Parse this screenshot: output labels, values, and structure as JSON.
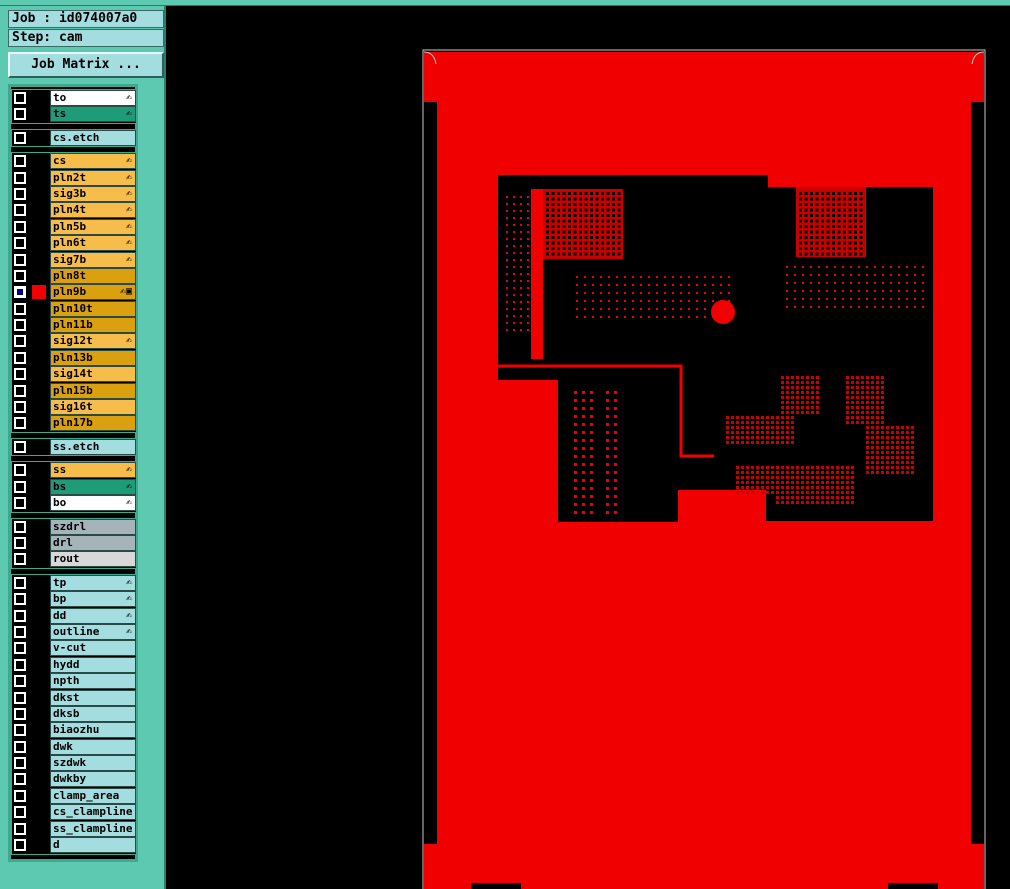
{
  "job": {
    "label": "Job : id074007a0"
  },
  "step": {
    "label": "Step: cam"
  },
  "job_matrix_button": "Job Matrix ...",
  "colors": {
    "panel": "#5cc9b0",
    "layer_white": "#ffffff",
    "layer_green": "#1e9c78",
    "layer_cyan": "#a4dde0",
    "layer_orange": "#f7bd4a",
    "layer_darkorange": "#dba00f",
    "layer_gray": "#a6b3b8",
    "layer_lightgray": "#d8d8d8",
    "board_red": "#f00000"
  },
  "layer_groups": [
    {
      "layers": [
        {
          "name": "to",
          "color": "#ffffff",
          "flag": "✍"
        },
        {
          "name": "ts",
          "color": "#1e9c78",
          "flag": "✍"
        }
      ]
    },
    {
      "layers": [
        {
          "name": "cs.etch",
          "color": "#a4dde0",
          "flag": ""
        }
      ]
    },
    {
      "layers": [
        {
          "name": "cs",
          "color": "#f7bd4a",
          "flag": "✍"
        },
        {
          "name": "pln2t",
          "color": "#f7bd4a",
          "flag": "✍"
        },
        {
          "name": "sig3b",
          "color": "#f7bd4a",
          "flag": "✍"
        },
        {
          "name": "pln4t",
          "color": "#f7bd4a",
          "flag": "✍"
        },
        {
          "name": "pln5b",
          "color": "#f7bd4a",
          "flag": "✍"
        },
        {
          "name": "pln6t",
          "color": "#f7bd4a",
          "flag": "✍"
        },
        {
          "name": "sig7b",
          "color": "#f7bd4a",
          "flag": "✍"
        },
        {
          "name": "pln8t",
          "color": "#dba00f",
          "flag": ""
        },
        {
          "name": "pln9b",
          "color": "#dba00f",
          "flag": "✍▣",
          "active": true,
          "swatch": "#f00000"
        },
        {
          "name": "pln10t",
          "color": "#dba00f",
          "flag": ""
        },
        {
          "name": "pln11b",
          "color": "#dba00f",
          "flag": ""
        },
        {
          "name": "sig12t",
          "color": "#f7bd4a",
          "flag": "✍"
        },
        {
          "name": "pln13b",
          "color": "#dba00f",
          "flag": ""
        },
        {
          "name": "sig14t",
          "color": "#f7bd4a",
          "flag": ""
        },
        {
          "name": "pln15b",
          "color": "#dba00f",
          "flag": ""
        },
        {
          "name": "sig16t",
          "color": "#f7bd4a",
          "flag": ""
        },
        {
          "name": "pln17b",
          "color": "#dba00f",
          "flag": ""
        }
      ]
    },
    {
      "layers": [
        {
          "name": "ss.etch",
          "color": "#a4dde0",
          "flag": ""
        }
      ]
    },
    {
      "layers": [
        {
          "name": "ss",
          "color": "#f7bd4a",
          "flag": "✍"
        },
        {
          "name": "bs",
          "color": "#1e9c78",
          "flag": "✍"
        },
        {
          "name": "bo",
          "color": "#ffffff",
          "flag": "✍"
        }
      ]
    },
    {
      "layers": [
        {
          "name": "szdrl",
          "color": "#a6b3b8",
          "flag": ""
        },
        {
          "name": "drl",
          "color": "#a6b3b8",
          "flag": ""
        },
        {
          "name": "rout",
          "color": "#d8d8d8",
          "flag": ""
        }
      ]
    },
    {
      "layers": [
        {
          "name": "tp",
          "color": "#a4dde0",
          "flag": "✍"
        },
        {
          "name": "bp",
          "color": "#a4dde0",
          "flag": "✍"
        },
        {
          "name": "dd",
          "color": "#a4dde0",
          "flag": "✍"
        },
        {
          "name": "outline",
          "color": "#a4dde0",
          "flag": "✍"
        },
        {
          "name": "v-cut",
          "color": "#a4dde0",
          "flag": ""
        },
        {
          "name": "hydd",
          "color": "#a4dde0",
          "flag": ""
        },
        {
          "name": "npth",
          "color": "#a4dde0",
          "flag": ""
        },
        {
          "name": "dkst",
          "color": "#a4dde0",
          "flag": ""
        },
        {
          "name": "dksb",
          "color": "#a4dde0",
          "flag": ""
        },
        {
          "name": "biaozhu",
          "color": "#a4dde0",
          "flag": ""
        },
        {
          "name": "dwk",
          "color": "#a4dde0",
          "flag": ""
        },
        {
          "name": "szdwk",
          "color": "#a4dde0",
          "flag": ""
        },
        {
          "name": "dwkby",
          "color": "#a4dde0",
          "flag": ""
        },
        {
          "name": "clamp_area",
          "color": "#a4dde0",
          "flag": ""
        },
        {
          "name": "cs_clampline",
          "color": "#a4dde0",
          "flag": ""
        },
        {
          "name": "ss_clampline",
          "color": "#a4dde0",
          "flag": ""
        },
        {
          "name": "d",
          "color": "#a4dde0",
          "flag": ""
        }
      ]
    }
  ]
}
